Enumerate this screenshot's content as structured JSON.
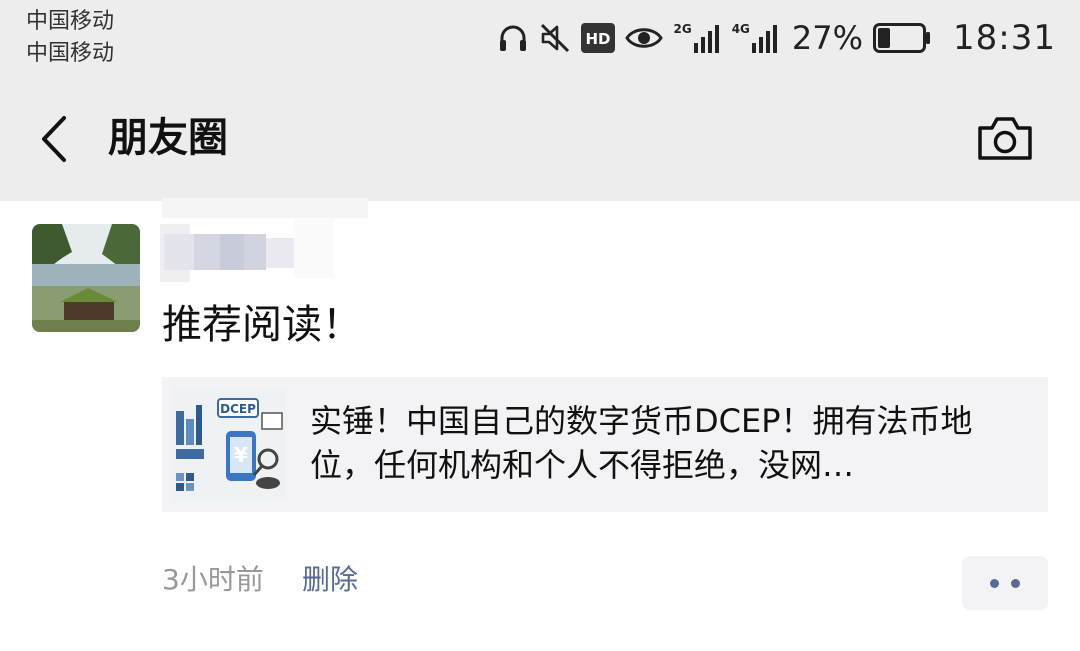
{
  "status_bar": {
    "carrier_1": "中国移动",
    "carrier_2": "中国移动",
    "hd_label": "HD",
    "network_1": "2G",
    "network_2": "4G",
    "battery_percent": "27%",
    "battery_level": 0.27,
    "time": "18:31",
    "icons": [
      "headphones-icon",
      "mute-icon",
      "hd-icon",
      "eye-icon",
      "signal-2g-icon",
      "signal-4g-icon",
      "battery-icon"
    ]
  },
  "header": {
    "title": "朋友圈",
    "back_icon": "chevron-left-icon",
    "camera_icon": "camera-icon"
  },
  "post": {
    "text": "推荐阅读！",
    "shared_article": {
      "title": "实锤！中国自己的数字货币DCEP！拥有法币地位，任何机构和个人不得拒绝，没网…",
      "thumbnail_text": "DCEP"
    },
    "time": "3小时前",
    "delete_label": "删除",
    "more_icon": "more-dots-icon"
  },
  "colors": {
    "header_bg": "#ededed",
    "link": "#576b95",
    "card_bg": "#f3f3f5",
    "meta_text": "#999999"
  }
}
